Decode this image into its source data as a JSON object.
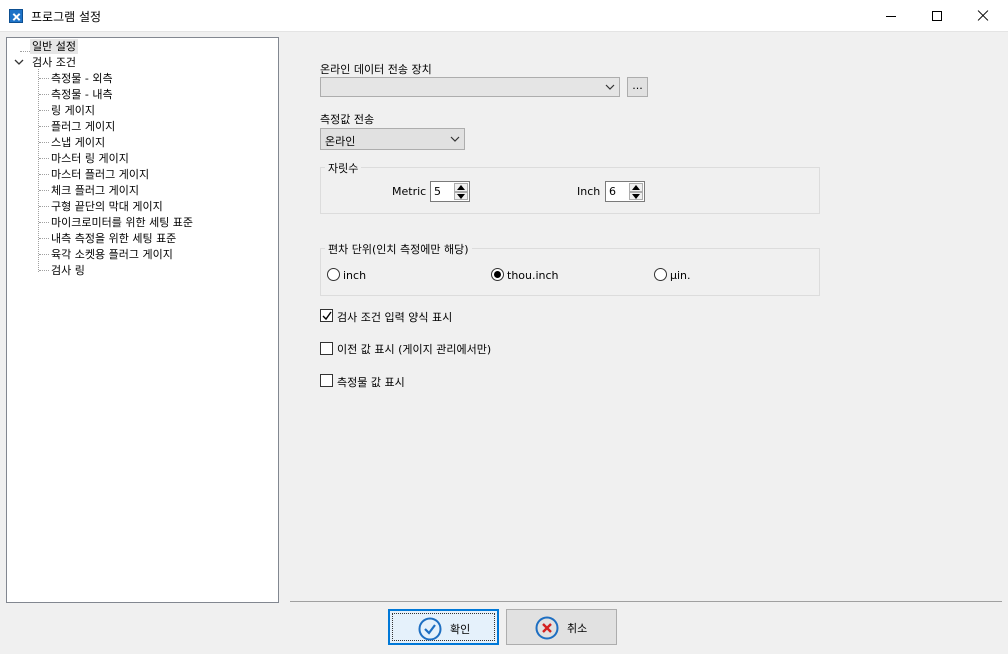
{
  "window": {
    "title": "프로그램 설정"
  },
  "tree": {
    "root_items": [
      {
        "label": "일반 설정",
        "selected": true
      },
      {
        "label": "검사 조건",
        "expanded": true
      }
    ],
    "children": [
      "측정물 - 외측",
      "측정물 - 내측",
      "링 게이지",
      "플러그 게이지",
      "스냅 게이지",
      "마스터 링 게이지",
      "마스터 플러그 게이지",
      "체크 플러그 게이지",
      "구형 끝단의 막대 게이지",
      "마이크로미터를 위한 세팅 표준",
      "내측 측정을 위한 세팅 표준",
      "육각 소켓용 플러그 게이지",
      "검사 링"
    ]
  },
  "settings": {
    "online_device_label": "온라인 데이터 전송 장치",
    "online_device_value": "",
    "browse_label": "...",
    "transfer_label": "측정값 전송",
    "transfer_value": "온라인",
    "digits_group": "자릿수",
    "metric_label": "Metric",
    "metric_value": "5",
    "inch_label": "Inch",
    "inch_value": "6",
    "deviation_group": "편차 단위(인치 측정에만 해당)",
    "radio_options": [
      "inch",
      "thou.inch",
      "µin."
    ],
    "radio_selected": "thou.inch",
    "checkboxes": [
      {
        "label": "검사 조건 입력 양식 표시",
        "checked": true
      },
      {
        "label": "이전 값 표시 (게이지 관리에서만)",
        "checked": false
      },
      {
        "label": "측정물 값 표시",
        "checked": false
      }
    ]
  },
  "buttons": {
    "ok_label": "확인",
    "cancel_label": "취소"
  },
  "colors": {
    "ok_icon": "#1e6fc2",
    "cancel_icon": "#d32020",
    "default_border": "#0078d7"
  }
}
